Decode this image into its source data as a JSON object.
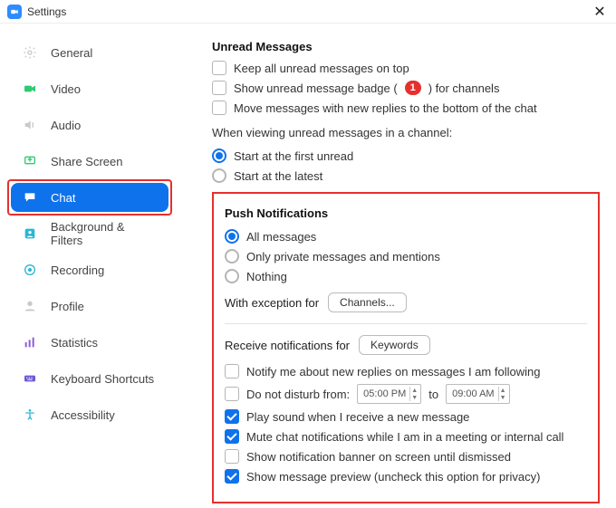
{
  "titlebar": {
    "title": "Settings"
  },
  "sidebar": {
    "items": [
      {
        "label": "General",
        "icon": "gear",
        "color": "#c9c9c9"
      },
      {
        "label": "Video",
        "icon": "video",
        "color": "#2ecc71"
      },
      {
        "label": "Audio",
        "icon": "audio",
        "color": "#c9c9c9"
      },
      {
        "label": "Share Screen",
        "icon": "share",
        "color": "#2ecc71"
      },
      {
        "label": "Chat",
        "icon": "chat",
        "color": "#ffffff",
        "active": true
      },
      {
        "label": "Background & Filters",
        "icon": "bg",
        "color": "#2bb6d6"
      },
      {
        "label": "Recording",
        "icon": "rec",
        "color": "#2bb6d6"
      },
      {
        "label": "Profile",
        "icon": "profile",
        "color": "#c9c9c9"
      },
      {
        "label": "Statistics",
        "icon": "stats",
        "color": "#8e5bd8"
      },
      {
        "label": "Keyboard Shortcuts",
        "icon": "kbd",
        "color": "#7058d6"
      },
      {
        "label": "Accessibility",
        "icon": "access",
        "color": "#2bb6d6"
      }
    ]
  },
  "unread": {
    "title": "Unread Messages",
    "keep_top": {
      "label": "Keep all unread messages on top",
      "checked": false
    },
    "badge_before": "Show unread message badge (",
    "badge_count": "1",
    "badge_after": ") for channels",
    "badge_checked": false,
    "move_bottom": {
      "label": "Move messages with new replies to the bottom of the chat",
      "checked": false
    },
    "viewing_label": "When viewing unread messages in a channel:",
    "r1": {
      "label": "Start at the first unread",
      "selected": true
    },
    "r2": {
      "label": "Start at the latest",
      "selected": false
    }
  },
  "push": {
    "title": "Push Notifications",
    "opt_all": {
      "label": "All messages",
      "selected": true
    },
    "opt_priv": {
      "label": "Only private messages and mentions",
      "selected": false
    },
    "opt_none": {
      "label": "Nothing",
      "selected": false
    },
    "exception_label": "With exception for",
    "channels_btn": "Channels...",
    "receive_label": "Receive notifications for",
    "keywords_btn": "Keywords",
    "follow": {
      "label": "Notify me about new replies on messages I am following",
      "checked": false
    },
    "dnd_label": "Do not disturb from:",
    "dnd_from": "05:00 PM",
    "dnd_to_label": "to",
    "dnd_to": "09:00 AM",
    "dnd_checked": false,
    "play_sound": {
      "label": "Play sound when I receive a new message",
      "checked": true
    },
    "mute_meeting": {
      "label": "Mute chat notifications while I am in a meeting or internal call",
      "checked": true
    },
    "banner": {
      "label": "Show notification banner on screen until dismissed",
      "checked": false
    },
    "preview": {
      "label": "Show message preview (uncheck this option for privacy)",
      "checked": true
    }
  }
}
